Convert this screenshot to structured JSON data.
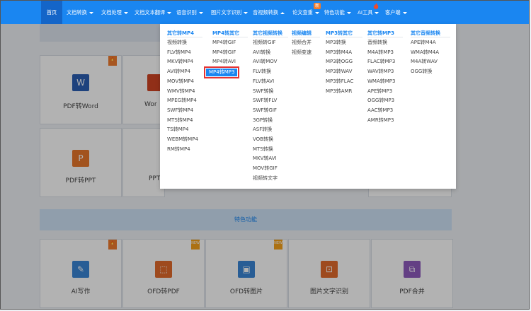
{
  "nav": {
    "items": [
      {
        "label": "首页",
        "active": true,
        "caret": false
      },
      {
        "label": "文档转换",
        "caret": "down"
      },
      {
        "label": "文档处理",
        "caret": "down"
      },
      {
        "label": "文档文本翻译",
        "caret": "down"
      },
      {
        "label": "语音识别",
        "caret": "down"
      },
      {
        "label": "图片文字识别",
        "caret": "down"
      },
      {
        "label": "音视频转换",
        "caret": "up"
      },
      {
        "label": "论文查重",
        "caret": "down"
      },
      {
        "label": "特色功能",
        "caret": "down"
      },
      {
        "label": "AI工具",
        "caret": "down"
      },
      {
        "label": "客户端",
        "caret": "down"
      }
    ],
    "new_badge": "新"
  },
  "dropdown": {
    "columns": [
      {
        "header": "其它转MP4",
        "items": [
          "视频转换",
          "FLV转MP4",
          "MKV转MP4",
          "AVI转MP4",
          "MOV转MP4",
          "WMV转MP4",
          "MPEG转MP4",
          "SWF转MP4",
          "MTS转MP4",
          "TS转MP4",
          "WEBM转MP4",
          "RM转MP4"
        ]
      },
      {
        "header": "MP4转其它",
        "items": [
          "MP4转GIF",
          "MP4转GIF",
          "MP4转AVI",
          "MP4转MP3"
        ],
        "selected": 3
      },
      {
        "header": "其它视频转换",
        "items": [
          "视频转GIF",
          "AVI转换",
          "AVI转MOV",
          "FLV转换",
          "FLV转AVI",
          "SWF转换",
          "SWF转FLV",
          "SWF转GIF",
          "3GP转换",
          "ASF转换",
          "VOB转换",
          "MTS转换",
          "MKV转AVI",
          "MOV转GIF",
          "视频转文字"
        ]
      },
      {
        "header": "视频编辑",
        "items": [
          "视频合并",
          "视频变速"
        ]
      },
      {
        "header": "MP3转其它",
        "items": [
          "MP3转换",
          "MP3转M4A",
          "MP3转OGG",
          "MP3转WAV",
          "MP3转FLAC",
          "MP3转AMR"
        ]
      },
      {
        "header": "其它转MP3",
        "items": [
          "音频转换",
          "M4A转MP3",
          "FLAC转MP3",
          "WAV转MP3",
          "WMA转MP3",
          "APE转MP3",
          "OGG转MP3",
          "AAC转MP3",
          "AMR转MP3"
        ]
      },
      {
        "header": "其它音频转换",
        "items": [
          "APE转M4A",
          "WMA转M4A",
          "M4A转WAV",
          "OGG转换"
        ]
      }
    ]
  },
  "cards_row1": [
    {
      "label": "PDF转Word",
      "icon": "W",
      "color": "#2b5fb4",
      "tag": "hot"
    },
    {
      "label": "Wor",
      "icon": "P",
      "color": "#d04423"
    }
  ],
  "cards_row2": [
    {
      "label": "PDF转PPT",
      "icon": "P",
      "color": "#e8772b"
    },
    {
      "label": "PPT",
      "icon": "",
      "color": "#e8772b"
    }
  ],
  "section": {
    "title": "特色功能"
  },
  "cards_row3": [
    {
      "label": "AI写作",
      "icon": "✎",
      "color": "#3a86d6",
      "tag": "hot"
    },
    {
      "label": "OFD转PDF",
      "icon": "⬚",
      "color": "#e36b2c",
      "tag": "new",
      "tag_text": "NEW"
    },
    {
      "label": "OFD转图片",
      "icon": "▣",
      "color": "#3a86d6",
      "tag": "new",
      "tag_text": "NEW"
    },
    {
      "label": "图片文字识别",
      "icon": "⊡",
      "color": "#e36b2c"
    },
    {
      "label": "PDF合并",
      "icon": "⧉",
      "color": "#8e5bbd"
    }
  ]
}
